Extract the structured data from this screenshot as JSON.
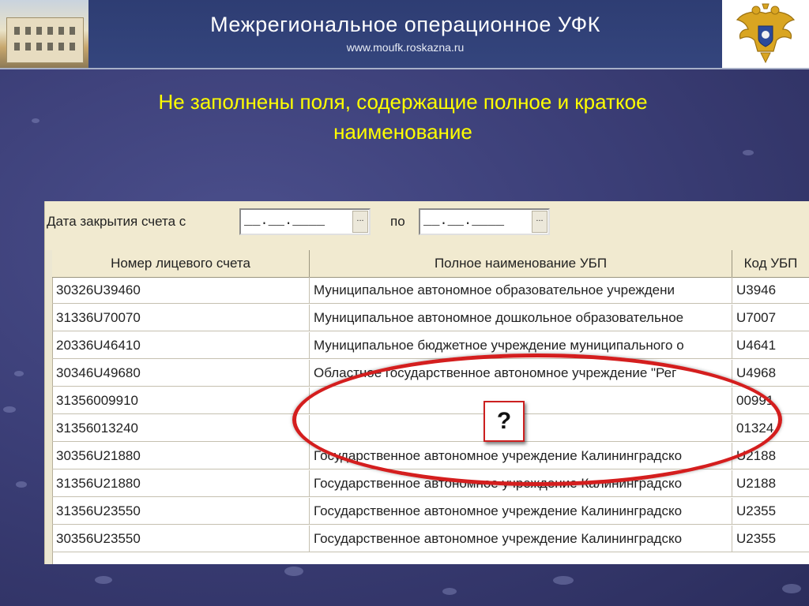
{
  "banner": {
    "title": "Межрегиональное операционное УФК",
    "url": "www.moufk.roskazna.ru",
    "photo": "building-photo",
    "emblem": "double-headed-eagle-emblem"
  },
  "slide": {
    "heading_line1": "Не заполнены поля, содержащие полное и краткое",
    "heading_line2": "наименование"
  },
  "filter": {
    "date_label": "Дата закрытия счета с",
    "date_from_value": "__.__.____",
    "to_label": "по",
    "date_to_value": "__.__.____",
    "picker_button_label": "..."
  },
  "grid": {
    "columns": [
      "Номер лицевого счета",
      "Полное наименование УБП",
      "Код УБП"
    ],
    "rows": [
      {
        "account": "30326U39460",
        "name": "Муниципальное автономное образовательное учреждени",
        "code": "U3946"
      },
      {
        "account": "31336U70070",
        "name": "Муниципальное автономное дошкольное образовательное",
        "code": "U7007"
      },
      {
        "account": "20336U46410",
        "name": "Муниципальное бюджетное учреждение муниципального о",
        "code": "U4641"
      },
      {
        "account": "30346U49680",
        "name": "Областное государственное автономное учреждение \"Рег",
        "code": "U4968"
      },
      {
        "account": "31356009910",
        "name": "",
        "code": "00991"
      },
      {
        "account": "31356013240",
        "name": "",
        "code": "01324"
      },
      {
        "account": "30356U21880",
        "name": "Государственное автономное учреждение Калининградско",
        "code": "U2188"
      },
      {
        "account": "31356U21880",
        "name": "Государственное автономное учреждение Калининградско",
        "code": "U2188"
      },
      {
        "account": "31356U23550",
        "name": "Государственное автономное учреждение Калининградско",
        "code": "U2355"
      },
      {
        "account": "30356U23550",
        "name": "Государственное автономное учреждение Калининградско",
        "code": "U2355"
      }
    ]
  },
  "annotation": {
    "question_mark": "?"
  },
  "colors": {
    "heading": "#ffff00",
    "annotation_ring": "#d41e1e",
    "banner_bg": "#2f3e6f"
  }
}
